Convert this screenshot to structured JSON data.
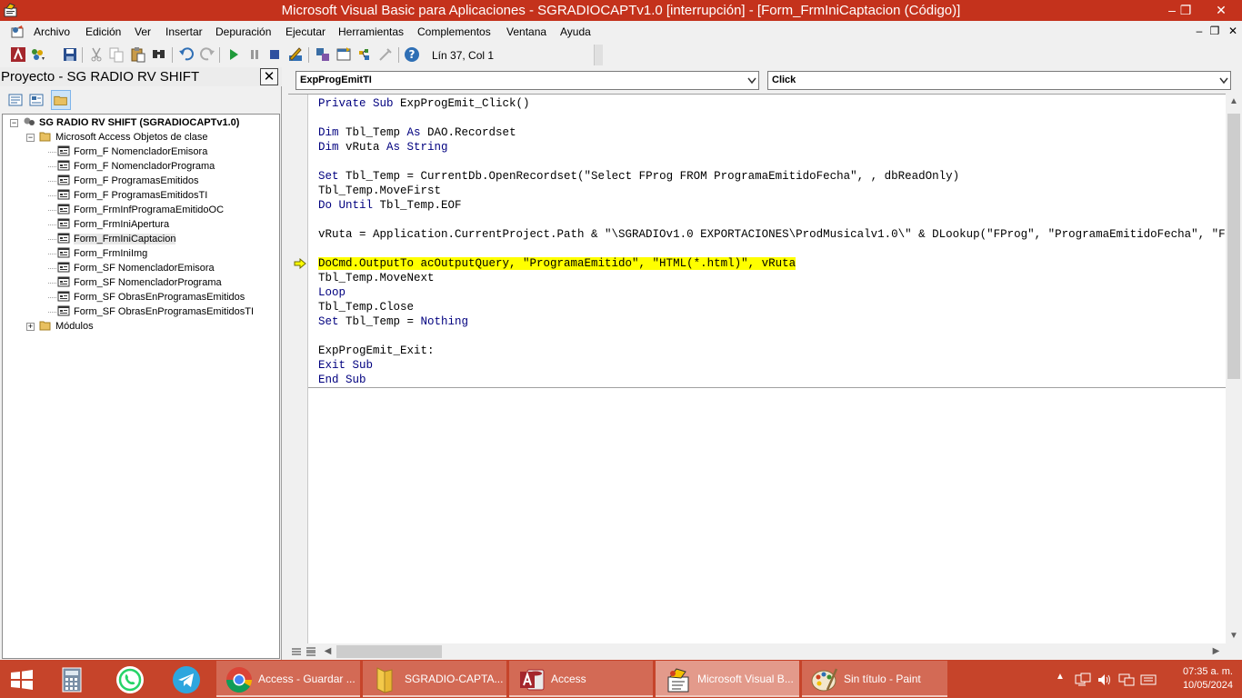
{
  "window": {
    "title": "Microsoft Visual Basic para Aplicaciones - SGRADIOCAPTv1.0 [interrupción] - [Form_FrmIniCaptacion (Código)]",
    "minimize": "–",
    "restore": "❐",
    "close": "✕"
  },
  "menu": {
    "items": [
      "Archivo",
      "Edición",
      "Ver",
      "Insertar",
      "Depuración",
      "Ejecutar",
      "Herramientas",
      "Complementos",
      "Ventana",
      "Ayuda"
    ],
    "mdi_minimize": "–",
    "mdi_restore": "❐",
    "mdi_close": "✕"
  },
  "toolbar": {
    "position_status": "Lín 37, Col 1"
  },
  "project": {
    "title": "Proyecto - SG RADIO RV SHIFT",
    "close": "✕",
    "root": "SG RADIO RV SHIFT (SGRADIOCAPTv1.0)",
    "folder": "Microsoft Access Objetos de clase",
    "items": [
      "Form_F NomencladorEmisora",
      "Form_F NomencladorPrograma",
      "Form_F ProgramasEmitidos",
      "Form_F ProgramasEmitidosTI",
      "Form_FrmInfProgramaEmitidoOC",
      "Form_FrmIniApertura",
      "Form_FrmIniCaptacion",
      "Form_FrmIniImg",
      "Form_SF NomencladorEmisora",
      "Form_SF NomencladorPrograma",
      "Form_SF ObrasEnProgramasEmitidos",
      "Form_SF ObrasEnProgramasEmitidosTI"
    ],
    "modules": "Módulos"
  },
  "editor": {
    "object_combo": "ExpProgEmitTI",
    "procedure_combo": "Click",
    "code_lines": [
      [
        {
          "t": "Private Sub",
          "k": 1
        },
        {
          "t": " ExpProgEmit_Click()"
        }
      ],
      [],
      [
        {
          "t": "Dim",
          "k": 1
        },
        {
          "t": " Tbl_Temp "
        },
        {
          "t": "As",
          "k": 1
        },
        {
          "t": " DAO.Recordset"
        }
      ],
      [
        {
          "t": "Dim",
          "k": 1
        },
        {
          "t": " vRuta "
        },
        {
          "t": "As String",
          "k": 1
        }
      ],
      [],
      [
        {
          "t": "Set",
          "k": 1
        },
        {
          "t": " Tbl_Temp = CurrentDb.OpenRecordset(\"Select FProg FROM ProgramaEmitidoFecha\", , dbReadOnly)"
        }
      ],
      [
        {
          "t": "Tbl_Temp.MoveFirst"
        }
      ],
      [
        {
          "t": "Do Until",
          "k": 1
        },
        {
          "t": " Tbl_Temp.EOF"
        }
      ],
      [],
      [
        {
          "t": "vRuta = Application.CurrentProject.Path & \"\\SGRADIOv1.0 EXPORTACIONES\\ProdMusicalv1.0\\\" & DLookup(\"FProg\", \"ProgramaEmitidoFecha\", \"FProg=#\" & Format(Tbl_Temp!FProg, \"mm/dd/yyyy\") & \"#\") & \".html\""
        }
      ],
      [],
      [
        {
          "t": "DoCmd.OutputTo acOutputQuery, \"ProgramaEmitido\", \"HTML(*.html)\", vRuta",
          "h": 1
        }
      ],
      [
        {
          "t": "Tbl_Temp.MoveNext"
        }
      ],
      [
        {
          "t": "Loop",
          "k": 1
        }
      ],
      [
        {
          "t": "Tbl_Temp.Close"
        }
      ],
      [
        {
          "t": "Set",
          "k": 1
        },
        {
          "t": " Tbl_Temp = "
        },
        {
          "t": "Nothing",
          "k": 1
        }
      ],
      [],
      [
        {
          "t": "ExpProgEmit_Exit:"
        }
      ],
      [
        {
          "t": "Exit Sub",
          "k": 1
        }
      ],
      [
        {
          "t": "End Sub",
          "k": 1
        }
      ]
    ]
  },
  "taskbar": {
    "buttons": [
      {
        "label": "Access - Guardar ...",
        "active": false
      },
      {
        "label": "SGRADIO-CAPTA...",
        "active": false
      },
      {
        "label": "Access",
        "active": false
      },
      {
        "label": "Microsoft Visual B...",
        "active": true
      },
      {
        "label": "Sin título - Paint",
        "active": false
      }
    ],
    "time": "07:35 a. m.",
    "date": "10/05/2024"
  },
  "colors": {
    "titlebar": "#c4321c",
    "taskbar": "#c6442a",
    "keyword": "#00007f",
    "highlight": "#ffff00"
  }
}
